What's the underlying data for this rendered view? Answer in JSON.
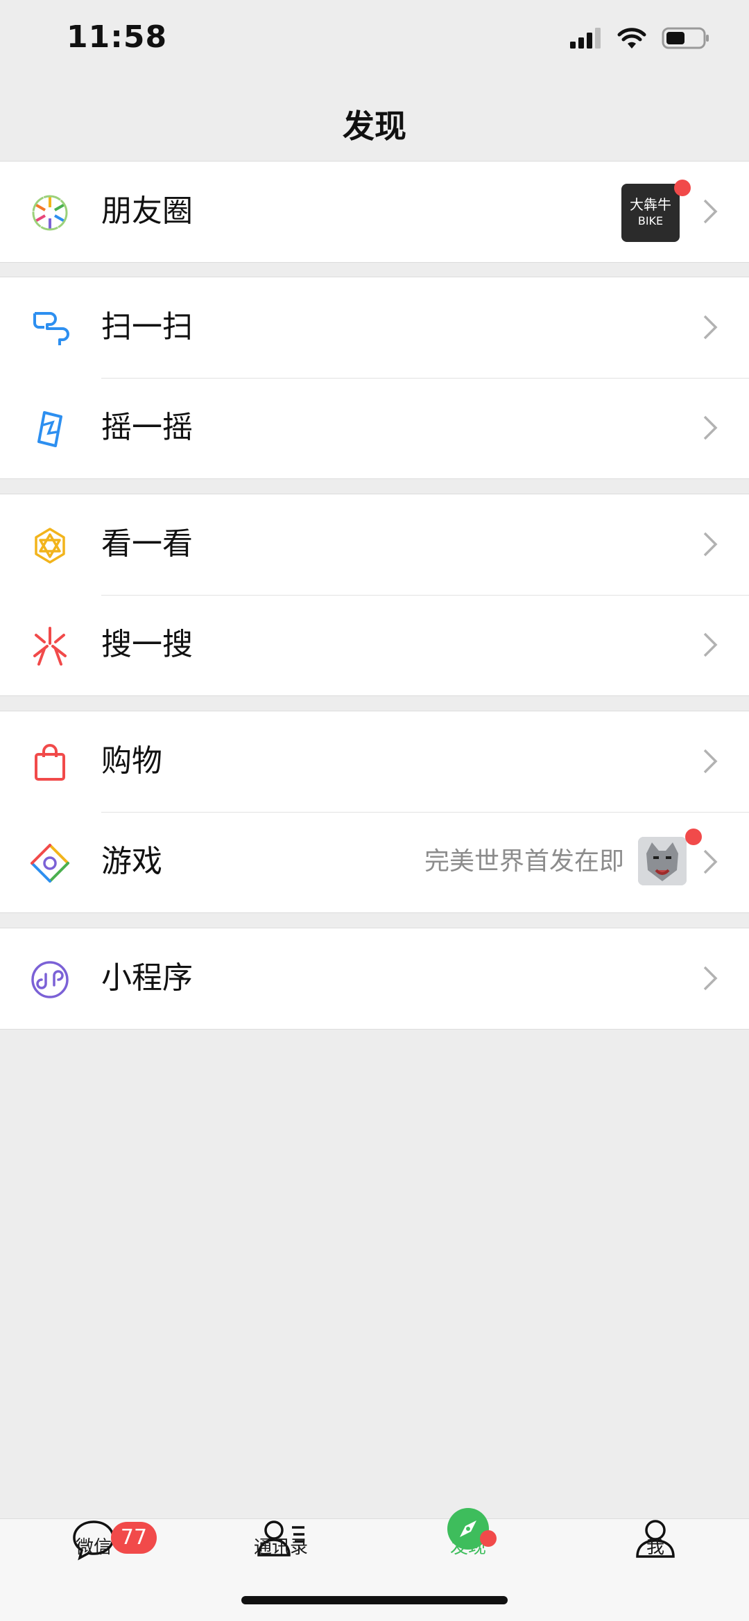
{
  "status_bar": {
    "time": "11:58"
  },
  "nav": {
    "title": "发现"
  },
  "menu": {
    "moments": {
      "label": "朋友圈"
    },
    "scan": {
      "label": "扫一扫"
    },
    "shake": {
      "label": "摇一摇"
    },
    "top_stories": {
      "label": "看一看"
    },
    "search": {
      "label": "搜一搜"
    },
    "shopping": {
      "label": "购物"
    },
    "games": {
      "label": "游戏",
      "hint": "完美世界首发在即"
    },
    "mini_programs": {
      "label": "小程序"
    }
  },
  "moments_thumb": {
    "line1": "大犇牛",
    "line2": "BIKE"
  },
  "tab_bar": {
    "chats": {
      "label": "微信",
      "badge": "77"
    },
    "contacts": {
      "label": "通讯录"
    },
    "discover": {
      "label": "发现"
    },
    "me": {
      "label": "我"
    }
  },
  "colors": {
    "badge_red": "#f14a4a",
    "discover_green": "#3ebd5c",
    "background": "#ededed"
  },
  "icons": [
    "signal-icon",
    "wifi-icon",
    "battery-icon",
    "moments-icon",
    "scan-icon",
    "shake-icon",
    "top-stories-icon",
    "search-icon",
    "shopping-icon",
    "games-icon",
    "mini-programs-icon",
    "chevron-right-icon",
    "chats-icon",
    "contacts-icon",
    "discover-icon",
    "me-icon"
  ]
}
